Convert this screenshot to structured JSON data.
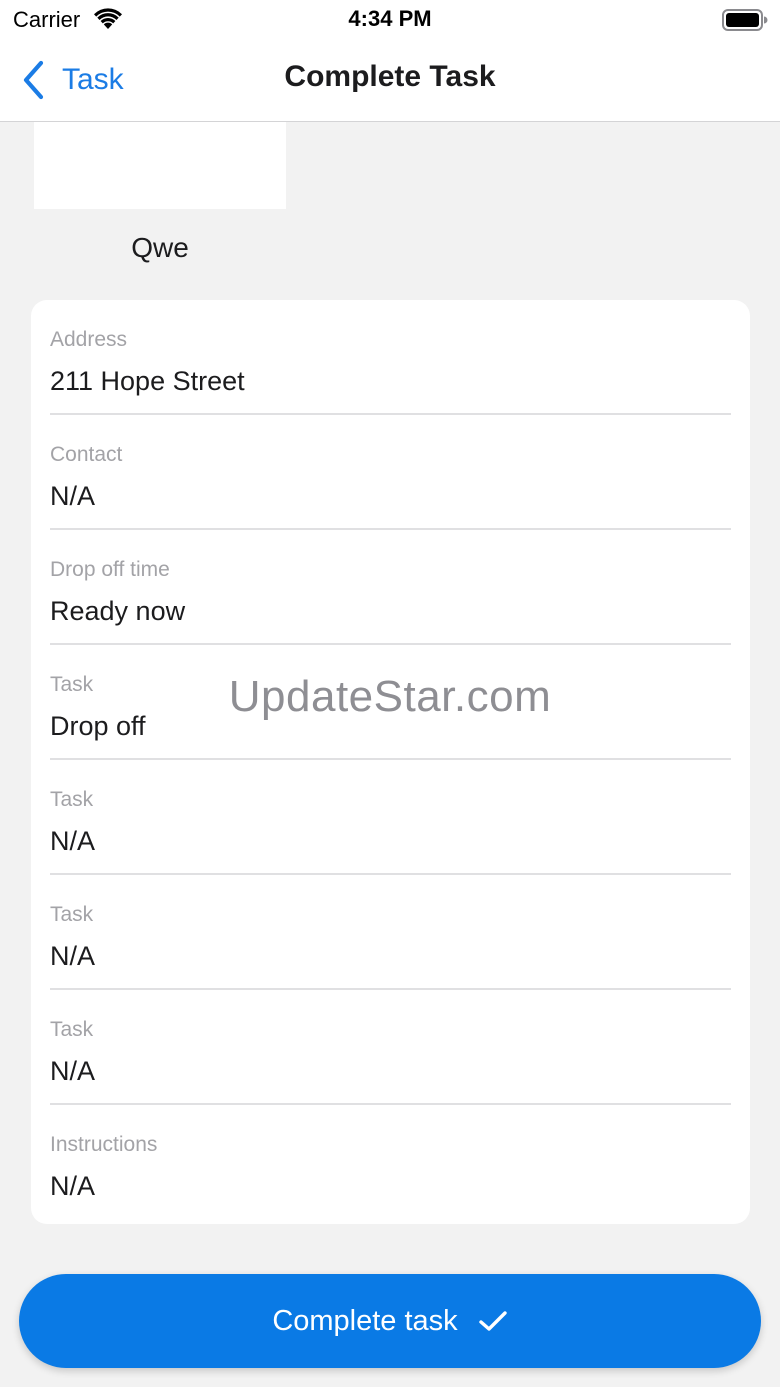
{
  "status_bar": {
    "carrier": "Carrier",
    "time": "4:34 PM",
    "icons": [
      "wifi-icon",
      "battery-icon"
    ]
  },
  "nav": {
    "back_label": "Task",
    "title": "Complete Task",
    "accent_color": "#1b7ce5"
  },
  "header": {
    "name": "Qwe"
  },
  "details": {
    "rows": [
      {
        "label": "Address",
        "value": "211 Hope Street"
      },
      {
        "label": "Contact",
        "value": "N/A"
      },
      {
        "label": "Drop off time",
        "value": "Ready now"
      },
      {
        "label": "Task",
        "value": "Drop off"
      },
      {
        "label": "Task",
        "value": "N/A"
      },
      {
        "label": "Task",
        "value": "N/A"
      },
      {
        "label": "Task",
        "value": "N/A"
      },
      {
        "label": "Instructions",
        "value": "N/A"
      }
    ]
  },
  "watermark": "UpdateStar.com",
  "actions": {
    "complete_label": "Complete task",
    "complete_icon": "checkmark-icon",
    "button_color": "#0a7ae5"
  }
}
